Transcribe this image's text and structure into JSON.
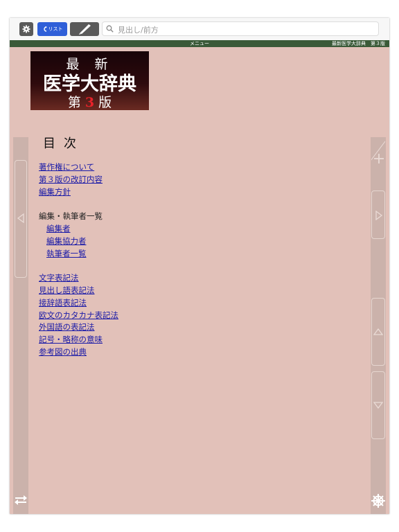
{
  "toolbar": {
    "settings_icon": "gear-icon",
    "list_label": "リスト",
    "list_icon": "back-arrow-icon",
    "pen_icon": "pen-icon",
    "search_placeholder": "見出し/前方"
  },
  "menubar": {
    "title": "メニュー",
    "book_label": "最新医学大辞典　第３版"
  },
  "cover": {
    "line1": "最 新",
    "line2": "医学大辞典",
    "edition_prefix": "第",
    "edition_number": "3",
    "edition_suffix": "版"
  },
  "toc": {
    "heading": "目次",
    "group1": [
      "著作権について",
      "第３版の改訂内容",
      "編集方針"
    ],
    "group2_heading": "編集・執筆者一覧",
    "group2": [
      "編集者",
      "編集協力者",
      "執筆者一覧"
    ],
    "group3": [
      "文字表記法",
      "見出し語表記法",
      "接辞語表記法",
      "欧文のカタカナ表記法",
      "外国語の表記法",
      "記号・略称の意味",
      "参考図の出典"
    ]
  },
  "colors": {
    "page_bg": "#e2c1b9",
    "menubar_bg": "#3a5a38",
    "list_button": "#2f5fd8",
    "link": "#1a1aa8",
    "cover_red": "#e8222a"
  }
}
